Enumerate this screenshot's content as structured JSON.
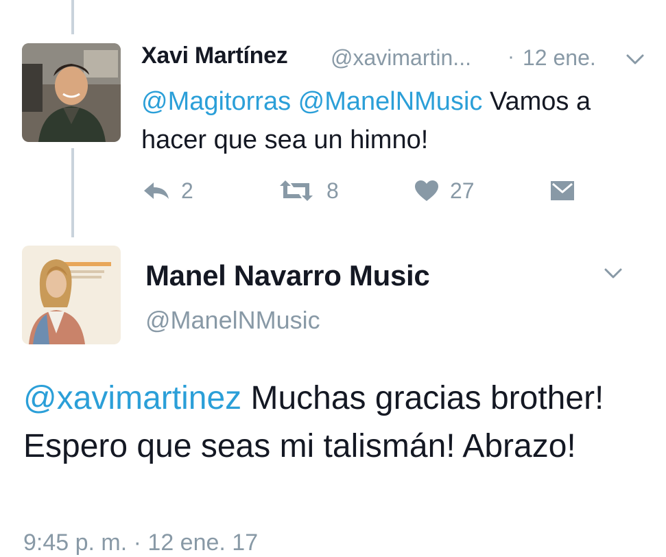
{
  "tweet1": {
    "author_name": "Xavi Martínez",
    "author_handle": "@xavimartin...",
    "separator": "·",
    "timestamp": "12 ene.",
    "mention1": "@Magitorras",
    "mention2": "@ManelNMusic",
    "text": "Vamos a hacer que sea un himno!",
    "reply_count": "2",
    "retweet_count": "8",
    "like_count": "27"
  },
  "tweet2": {
    "author_name": "Manel Navarro Music",
    "author_handle": "@ManelNMusic",
    "mention": "@xavimartinez",
    "text": "Muchas gracias brother! Espero que seas mi talismán! Abrazo!",
    "timestamp": "9:45 p. m. · 12 ene. 17"
  },
  "icons": {
    "reply": "reply-icon",
    "retweet": "retweet-icon",
    "like": "heart-icon",
    "dm": "envelope-icon",
    "more": "chevron-down-icon"
  },
  "colors": {
    "link": "#2b9fd8",
    "meta": "#8899a6",
    "text": "#141823",
    "thread_line": "#c9d3dc"
  }
}
